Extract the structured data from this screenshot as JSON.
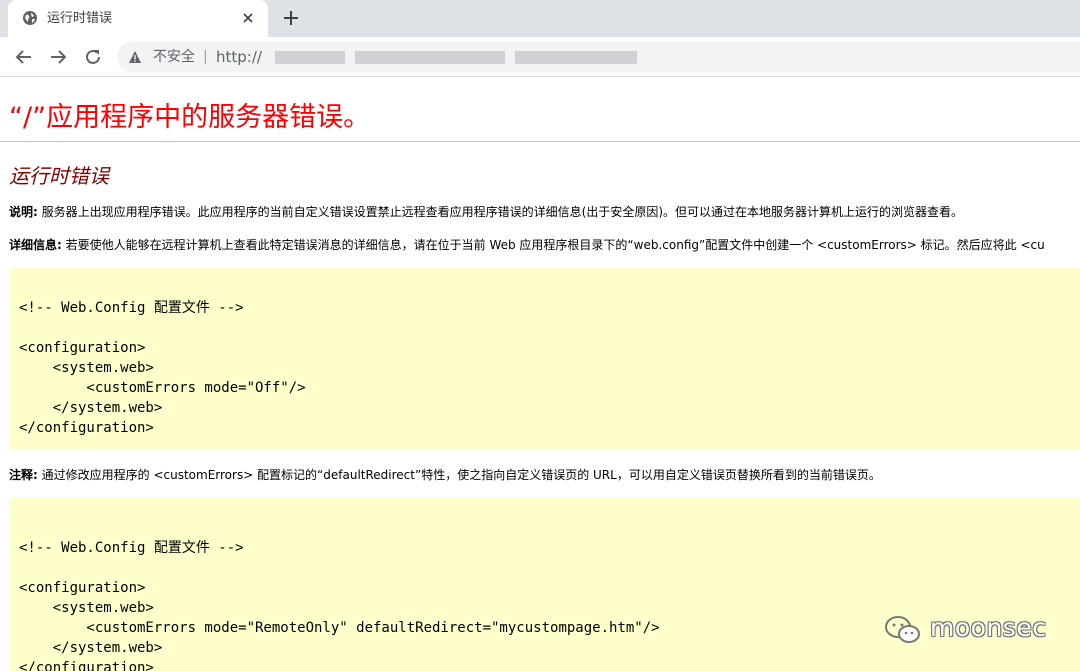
{
  "tab": {
    "title": "运行时错误"
  },
  "omnibox": {
    "security_label": "不安全",
    "separator": "|",
    "url_visible": "http://"
  },
  "page": {
    "heading": "“/”应用程序中的服务器错误。",
    "subheading": "运行时错误",
    "description": {
      "label": "说明:",
      "text": " 服务器上出现应用程序错误。此应用程序的当前自定义错误设置禁止远程查看应用程序错误的详细信息(出于安全原因)。但可以通过在本地服务器计算机上运行的浏览器查看。"
    },
    "details": {
      "label": "详细信息:",
      "text": " 若要使他人能够在远程计算机上查看此特定错误消息的详细信息，请在位于当前 Web 应用程序根目录下的“web.config”配置文件中创建一个 <customErrors> 标记。然后应将此 <cu"
    },
    "code1": "\n<!-- Web.Config 配置文件 -->\n\n<configuration>\n    <system.web>\n        <customErrors mode=\"Off\"/>\n    </system.web>\n</configuration>",
    "notes": {
      "label": "注释:",
      "text": " 通过修改应用程序的 <customErrors> 配置标记的“defaultRedirect”特性，使之指向自定义错误页的 URL，可以用自定义错误页替换所看到的当前错误页。"
    },
    "code2": "\n<!-- Web.Config 配置文件 -->\n\n<configuration>\n    <system.web>\n        <customErrors mode=\"RemoteOnly\" defaultRedirect=\"mycustompage.htm\"/>\n    </system.web>\n</configuration>"
  },
  "watermark": {
    "text": "moonsec"
  },
  "colors": {
    "heading": "#ff0000",
    "subheading": "#800000",
    "code_bg": "#ffffcc",
    "chrome_bg": "#dee1e6"
  },
  "icons": {
    "favicon": "globe-icon",
    "close": "close-icon",
    "new_tab": "plus-icon",
    "back": "arrow-left-icon",
    "forward": "arrow-right-icon",
    "reload": "reload-icon",
    "security": "warning-triangle-icon",
    "watermark": "wechat-icon"
  }
}
